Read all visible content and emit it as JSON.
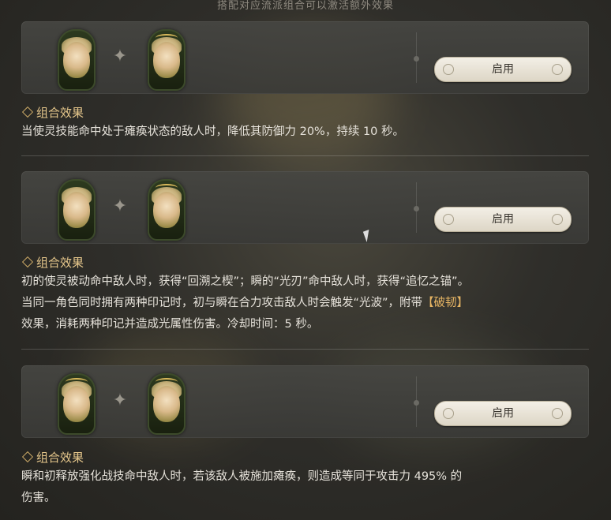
{
  "header": "搭配对应流派组合可以激活额外效果",
  "combos": [
    {
      "button_label": "启用",
      "effect_title": "组合效果",
      "effect_lines": [
        "当使灵技能命中处于瘫痪状态的敌人时，降低其防御力 20%，持续 10 秒。"
      ]
    },
    {
      "button_label": "启用",
      "effect_title": "组合效果",
      "effect_lines": [
        "初的使灵被动命中敌人时，获得“回溯之楔”；瞬的“光刃”命中敌人时，获得“追忆之锚”。",
        "当同一角色同时拥有两种印记时，初与瞬在合力攻击敌人时会触发“光波”，附带",
        "效果，消耗两种印记并造成光属性伤害。冷却时间：5 秒。"
      ],
      "keyword": "【破韧】"
    },
    {
      "button_label": "启用",
      "effect_title": "组合效果",
      "effect_lines": [
        "瞬和初释放强化战技命中敌人时，若该敌人被施加瘫痪，则造成等同于攻击力 495% 的",
        "伤害。"
      ]
    }
  ],
  "icons": {
    "plus": "plus-sparkle-icon",
    "diamond": "diamond-bullet-icon"
  },
  "colors": {
    "accent": "#e7c88c",
    "keyword": "#e8b664"
  }
}
